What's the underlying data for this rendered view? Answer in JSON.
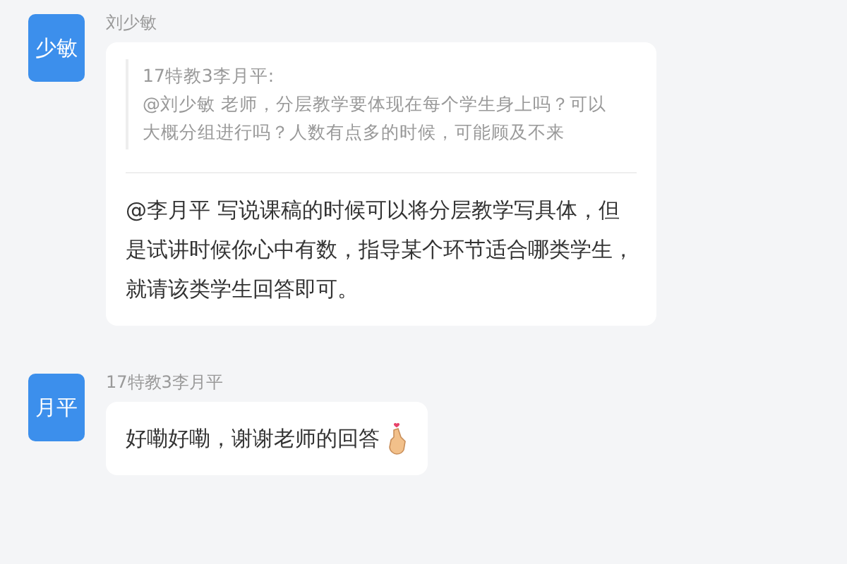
{
  "messages": [
    {
      "avatar": "少敏",
      "sender": "刘少敏",
      "quote": {
        "author": "17特教3李月平:",
        "text": "@刘少敏 老师，分层教学要体现在每个学生身上吗？可以大概分组进行吗？人数有点多的时候，可能顾及不来"
      },
      "text": "@李月平 写说课稿的时候可以将分层教学写具体，但是试讲时候你心中有数，指导某个环节适合哪类学生，就请该类学生回答即可。"
    },
    {
      "avatar": "月平",
      "sender": "17特教3李月平",
      "text": "好嘞好嘞，谢谢老师的回答",
      "emoji": true
    }
  ]
}
